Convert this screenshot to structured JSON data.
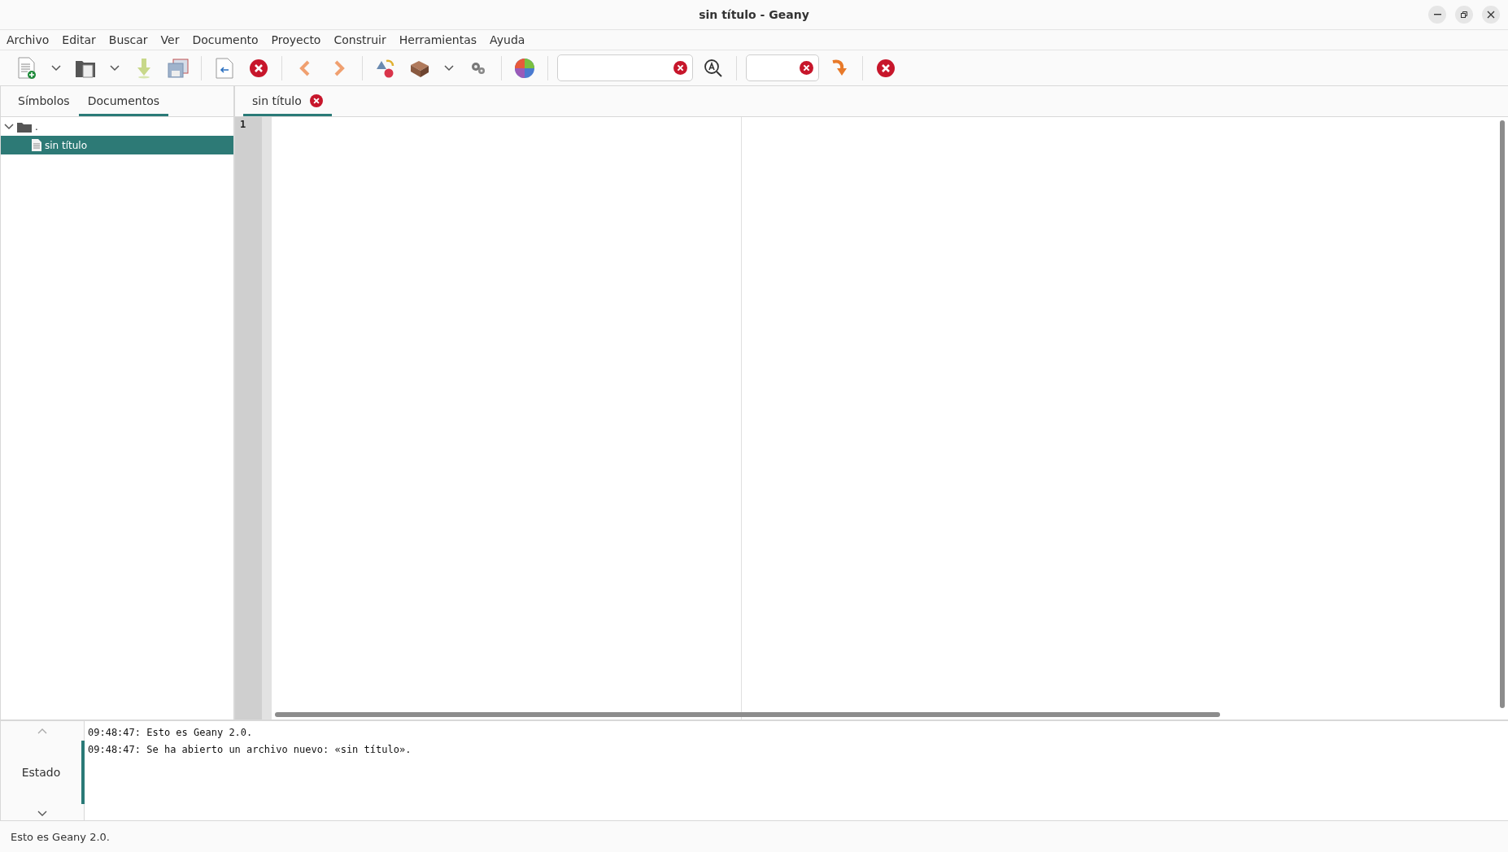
{
  "window": {
    "title": "sin título - Geany"
  },
  "menu": [
    "Archivo",
    "Editar",
    "Buscar",
    "Ver",
    "Documento",
    "Proyecto",
    "Construir",
    "Herramientas",
    "Ayuda"
  ],
  "sidebar": {
    "tabs": [
      {
        "label": "Símbolos",
        "selected": false
      },
      {
        "label": "Documentos",
        "selected": true
      }
    ],
    "tree": [
      {
        "label": ".",
        "kind": "folder",
        "expanded": true,
        "selected": false,
        "children": [
          {
            "label": "sin título",
            "kind": "file",
            "selected": true
          }
        ]
      }
    ]
  },
  "editor": {
    "tabs": [
      {
        "label": "sin título",
        "selected": true
      }
    ],
    "line_numbers": [
      "1"
    ]
  },
  "messages": {
    "tabs": [
      {
        "label": "Estado",
        "selected": true
      }
    ],
    "lines": [
      "09:48:47: Esto es Geany 2.0.",
      "09:48:47: Se ha abierto un archivo nuevo: «sin título»."
    ]
  },
  "status_bar": "Esto es Geany 2.0."
}
